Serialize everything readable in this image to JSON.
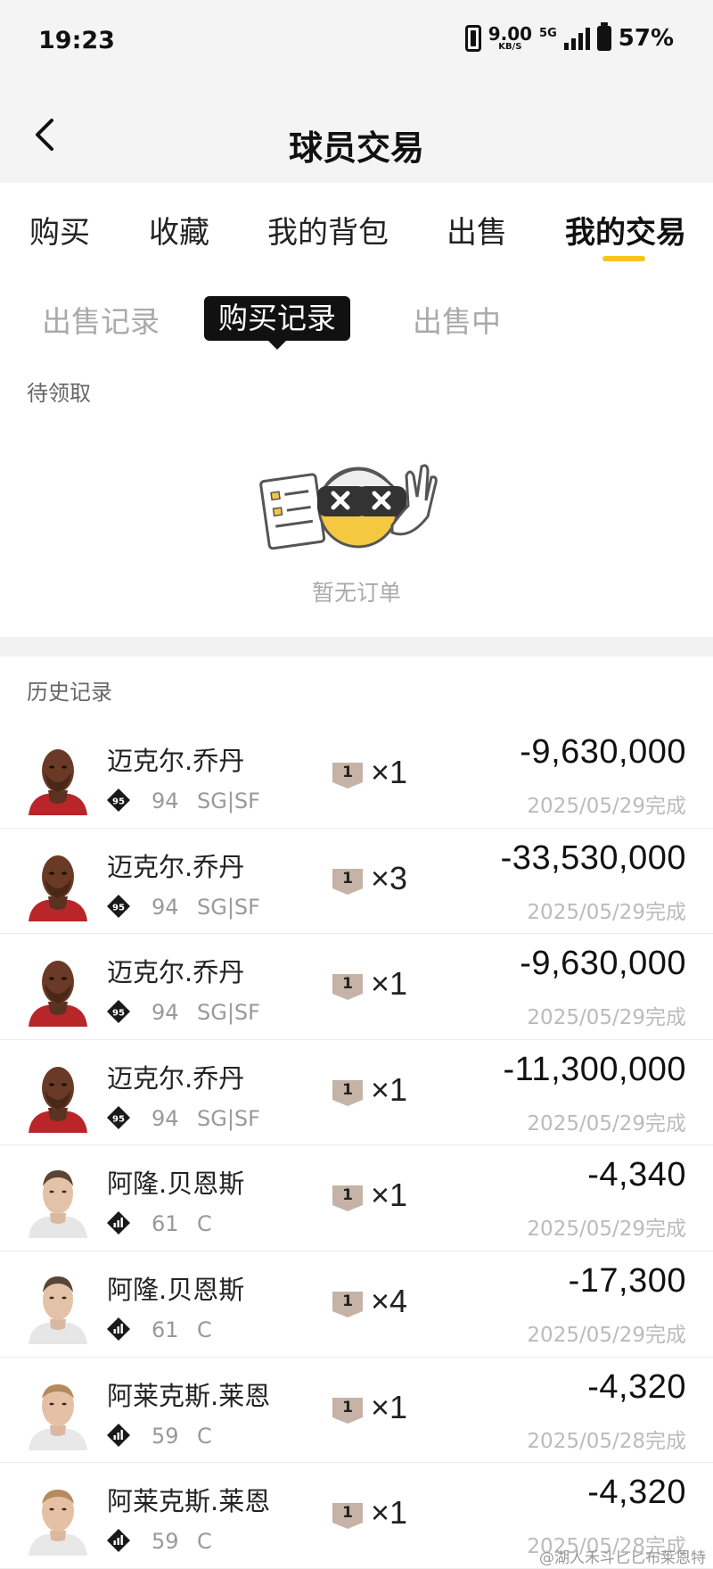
{
  "status_bar": {
    "time": "19:23",
    "net_speed": "9.00",
    "net_unit": "KB/S",
    "network": "5G",
    "battery": "57%"
  },
  "header": {
    "title": "球员交易",
    "back_icon": "chevron-left-icon"
  },
  "main_tabs": [
    "购买",
    "收藏",
    "我的背包",
    "出售",
    "我的交易"
  ],
  "main_tab_active": "我的交易",
  "accent_color": "#f5c518",
  "sub_tabs": [
    "出售记录",
    "购买记录",
    "出售中"
  ],
  "sub_tab_active": "购买记录",
  "pending": {
    "label": "待领取",
    "empty_text": "暂无订单"
  },
  "history": {
    "label": "历史记录",
    "records": [
      {
        "name": "迈克尔.乔丹",
        "badge": "95",
        "rating": "94",
        "position": "SG|SF",
        "card": "1",
        "qty": "×1",
        "price": "-9,630,000",
        "date_status": "2025/05/29完成",
        "avatar": "jordan"
      },
      {
        "name": "迈克尔.乔丹",
        "badge": "95",
        "rating": "94",
        "position": "SG|SF",
        "card": "1",
        "qty": "×3",
        "price": "-33,530,000",
        "date_status": "2025/05/29完成",
        "avatar": "jordan"
      },
      {
        "name": "迈克尔.乔丹",
        "badge": "95",
        "rating": "94",
        "position": "SG|SF",
        "card": "1",
        "qty": "×1",
        "price": "-9,630,000",
        "date_status": "2025/05/29完成",
        "avatar": "jordan"
      },
      {
        "name": "迈克尔.乔丹",
        "badge": "95",
        "rating": "94",
        "position": "SG|SF",
        "card": "1",
        "qty": "×1",
        "price": "-11,300,000",
        "date_status": "2025/05/29完成",
        "avatar": "jordan"
      },
      {
        "name": "阿隆.贝恩斯",
        "badge": "",
        "rating": "61",
        "position": "C",
        "card": "1",
        "qty": "×1",
        "price": "-4,340",
        "date_status": "2025/05/29完成",
        "avatar": "baynes"
      },
      {
        "name": "阿隆.贝恩斯",
        "badge": "",
        "rating": "61",
        "position": "C",
        "card": "1",
        "qty": "×4",
        "price": "-17,300",
        "date_status": "2025/05/29完成",
        "avatar": "baynes"
      },
      {
        "name": "阿莱克斯.莱恩",
        "badge": "",
        "rating": "59",
        "position": "C",
        "card": "1",
        "qty": "×1",
        "price": "-4,320",
        "date_status": "2025/05/28完成",
        "avatar": "len"
      },
      {
        "name": "阿莱克斯.莱恩",
        "badge": "",
        "rating": "59",
        "position": "C",
        "card": "1",
        "qty": "×1",
        "price": "-4,320",
        "date_status": "2025/05/28完成",
        "avatar": "len"
      }
    ]
  },
  "watermark": "@湖人禾斗匕匕布莱恩特"
}
